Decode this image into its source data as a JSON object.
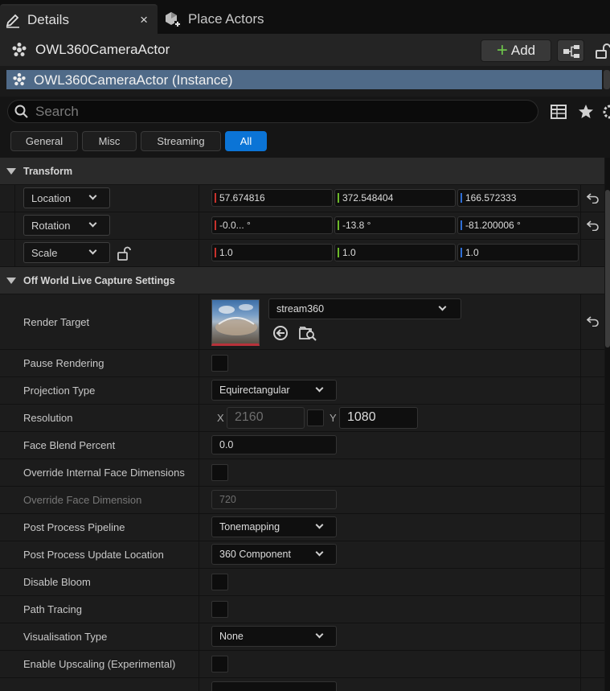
{
  "tabs": [
    {
      "label": "Details",
      "active": true,
      "icon": "pencil-icon",
      "close": "×"
    },
    {
      "label": "Place Actors",
      "active": false,
      "icon": "place-actors-icon"
    }
  ],
  "actor": {
    "name": "OWL360CameraActor",
    "icon": "camera-actor-icon",
    "add_label": "Add",
    "component_label": "OWL360CameraActor (Instance)"
  },
  "search": {
    "placeholder": "Search"
  },
  "filters": [
    {
      "label": "General",
      "active": false
    },
    {
      "label": "Misc",
      "active": false
    },
    {
      "label": "Streaming",
      "active": false
    },
    {
      "label": "All",
      "active": true
    }
  ],
  "transform": {
    "title": "Transform",
    "location": {
      "label": "Location",
      "x": "57.674816",
      "y": "372.548404",
      "z": "166.572333"
    },
    "rotation": {
      "label": "Rotation",
      "x": "-0.0... °",
      "y": "-13.8 °",
      "z": "-81.200006 °"
    },
    "scale": {
      "label": "Scale",
      "x": "1.0",
      "y": "1.0",
      "z": "1.0"
    }
  },
  "capture": {
    "title": "Off World Live Capture Settings",
    "render_target": {
      "label": "Render Target",
      "value": "stream360"
    },
    "pause_rendering": {
      "label": "Pause Rendering",
      "checked": false
    },
    "projection_type": {
      "label": "Projection Type",
      "value": "Equirectangular"
    },
    "resolution": {
      "label": "Resolution",
      "x_label": "X",
      "x": "2160",
      "y_label": "Y",
      "y": "1080"
    },
    "face_blend": {
      "label": "Face Blend Percent",
      "value": "0.0"
    },
    "override_internal": {
      "label": "Override Internal Face Dimensions",
      "checked": false
    },
    "override_face_dim": {
      "label": "Override Face Dimension",
      "value": "720"
    },
    "pp_pipeline": {
      "label": "Post Process Pipeline",
      "value": "Tonemapping"
    },
    "pp_update": {
      "label": "Post Process Update Location",
      "value": "360 Component"
    },
    "disable_bloom": {
      "label": "Disable Bloom",
      "checked": false
    },
    "path_tracing": {
      "label": "Path Tracing",
      "checked": false
    },
    "vis_type": {
      "label": "Visualisation Type",
      "value": "None"
    },
    "upscaling": {
      "label": "Enable Upscaling (Experimental)",
      "checked": false
    }
  },
  "colors": {
    "accent": "#0b74d6",
    "x_axis": "#c8322c",
    "y_axis": "#6cb82a",
    "z_axis": "#2f6fd6",
    "add_plus": "#6cc24a"
  }
}
